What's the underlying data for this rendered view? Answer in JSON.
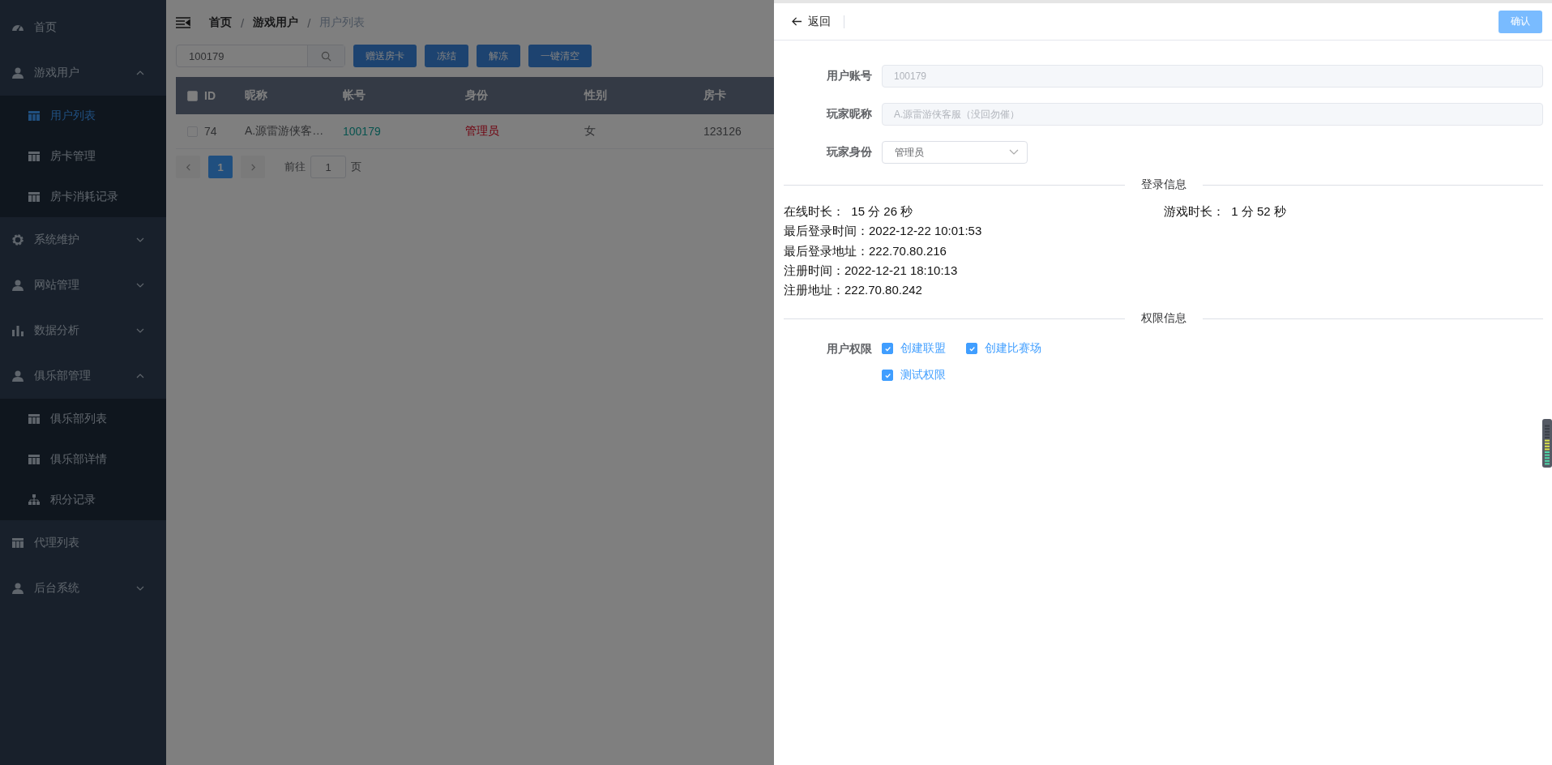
{
  "sidebar": {
    "items": [
      {
        "label": "首页",
        "kind": "dashboard"
      },
      {
        "label": "游戏用户",
        "kind": "user",
        "expanded": true,
        "children": [
          {
            "label": "用户列表",
            "kind": "table",
            "selected": true
          },
          {
            "label": "房卡管理",
            "kind": "table",
            "selected": false
          },
          {
            "label": "房卡消耗记录",
            "kind": "table",
            "selected": false
          }
        ]
      },
      {
        "label": "系统维护",
        "kind": "gear",
        "expanded": false
      },
      {
        "label": "网站管理",
        "kind": "user",
        "expanded": false
      },
      {
        "label": "数据分析",
        "kind": "chart",
        "expanded": false
      },
      {
        "label": "俱乐部管理",
        "kind": "user",
        "expanded": true,
        "children": [
          {
            "label": "俱乐部列表",
            "kind": "table",
            "selected": false
          },
          {
            "label": "俱乐部详情",
            "kind": "table",
            "selected": false
          },
          {
            "label": "积分记录",
            "kind": "tree",
            "selected": false
          }
        ]
      },
      {
        "label": "代理列表",
        "kind": "table"
      },
      {
        "label": "后台系统",
        "kind": "user",
        "expanded": false
      }
    ]
  },
  "breadcrumb": [
    "首页",
    "游戏用户",
    "用户列表"
  ],
  "breadcrumb_separators": [
    "/",
    "/"
  ],
  "toolbar": {
    "search_value": "100179",
    "buttons": [
      "赠送房卡",
      "冻结",
      "解冻",
      "一键清空"
    ]
  },
  "table": {
    "header_checked": false,
    "columns": [
      "ID",
      "昵称",
      "帐号",
      "身份",
      "性别",
      "房卡"
    ],
    "rows": [
      {
        "checked": false,
        "cells": [
          {
            "text": "74",
            "kind": "plain"
          },
          {
            "text": "A.源雷游侠客…",
            "kind": "plain"
          },
          {
            "text": "100179",
            "kind": "account"
          },
          {
            "text": "管理员",
            "kind": "role"
          },
          {
            "text": "女",
            "kind": "plain"
          },
          {
            "text": "123126",
            "kind": "plain"
          }
        ]
      }
    ]
  },
  "pagination": {
    "pages": [
      {
        "label": "1",
        "selected": true
      }
    ],
    "goto_label": "前往",
    "goto_value": "1",
    "page_unit": "页"
  },
  "drawer": {
    "back": "返回",
    "confirm": {
      "label": "确认",
      "disabled": true
    },
    "fields": [
      {
        "label": "用户账号",
        "kind": "input",
        "value": "100179",
        "disabled": true
      },
      {
        "label": "玩家昵称",
        "kind": "input",
        "value": "A.源雷游侠客服（没回勿催）",
        "disabled": true
      },
      {
        "label": "玩家身份",
        "kind": "select",
        "value": "管理员"
      }
    ],
    "login_title": "登录信息",
    "login_info": [
      {
        "label": "在线时长：",
        "value": "15 分 26 秒"
      },
      {
        "label": "游戏时长：",
        "value": "1 分 52 秒"
      },
      {
        "label": "最后登录时间：",
        "value": "2022-12-22 10:01:53"
      },
      {
        "label": "最后登录地址：",
        "value": "222.70.80.216"
      },
      {
        "label": "注册时间：",
        "value": "2022-12-21 18:10:13"
      },
      {
        "label": "注册地址：",
        "value": "222.70.80.242"
      }
    ],
    "perm_title": "权限信息",
    "perm_label": "用户权限",
    "permissions": [
      {
        "label": "创建联盟",
        "checked": true
      },
      {
        "label": "创建比赛场",
        "checked": true
      },
      {
        "label": "测试权限",
        "checked": true
      }
    ]
  }
}
